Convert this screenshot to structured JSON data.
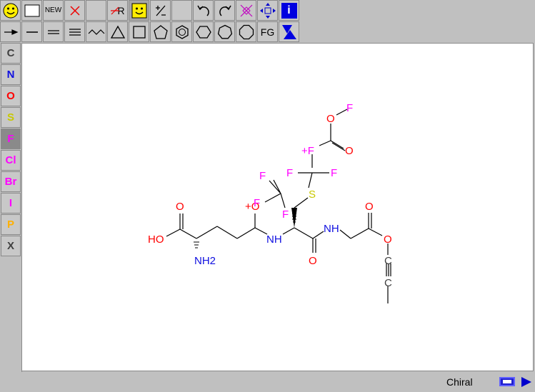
{
  "toolbar": {
    "new_label": "NEW",
    "r_label": "R",
    "fg_label": "FG",
    "info_label": "i"
  },
  "elements": [
    {
      "symbol": "C",
      "color": "#404040"
    },
    {
      "symbol": "N",
      "color": "#1010e0"
    },
    {
      "symbol": "O",
      "color": "#ff0000"
    },
    {
      "symbol": "S",
      "color": "#c8c800"
    },
    {
      "symbol": "F",
      "color": "#ff00ff"
    },
    {
      "symbol": "Cl",
      "color": "#ff00ff"
    },
    {
      "symbol": "Br",
      "color": "#ff00ff"
    },
    {
      "symbol": "I",
      "color": "#ff00ff"
    },
    {
      "symbol": "P",
      "color": "#ffb000"
    },
    {
      "symbol": "X",
      "color": "#404040"
    }
  ],
  "selected_element": "F",
  "molecule_labels": {
    "ho": "HO",
    "o_acid": "O",
    "nh2": "NH2",
    "o_plus": "+O",
    "nh1": "NH",
    "nh2b": "NH",
    "o_amide2": "O",
    "f_top": "F",
    "f_a": "F",
    "f_b": "F",
    "s": "S",
    "f_c": "F",
    "f_d": "F",
    "f_plus": "+F",
    "o_ester": "O",
    "o_link": "O",
    "f_end": "F",
    "o_gly": "O",
    "o_gly2": "O",
    "c1": "C",
    "c2": "C"
  },
  "colors": {
    "oxygen": "#ff0000",
    "nitrogen": "#1010e0",
    "fluorine": "#ff00ff",
    "sulfur": "#c8c800",
    "bond": "#000000",
    "carbon": "#404040"
  },
  "status": {
    "chiral_label": "Chiral"
  }
}
